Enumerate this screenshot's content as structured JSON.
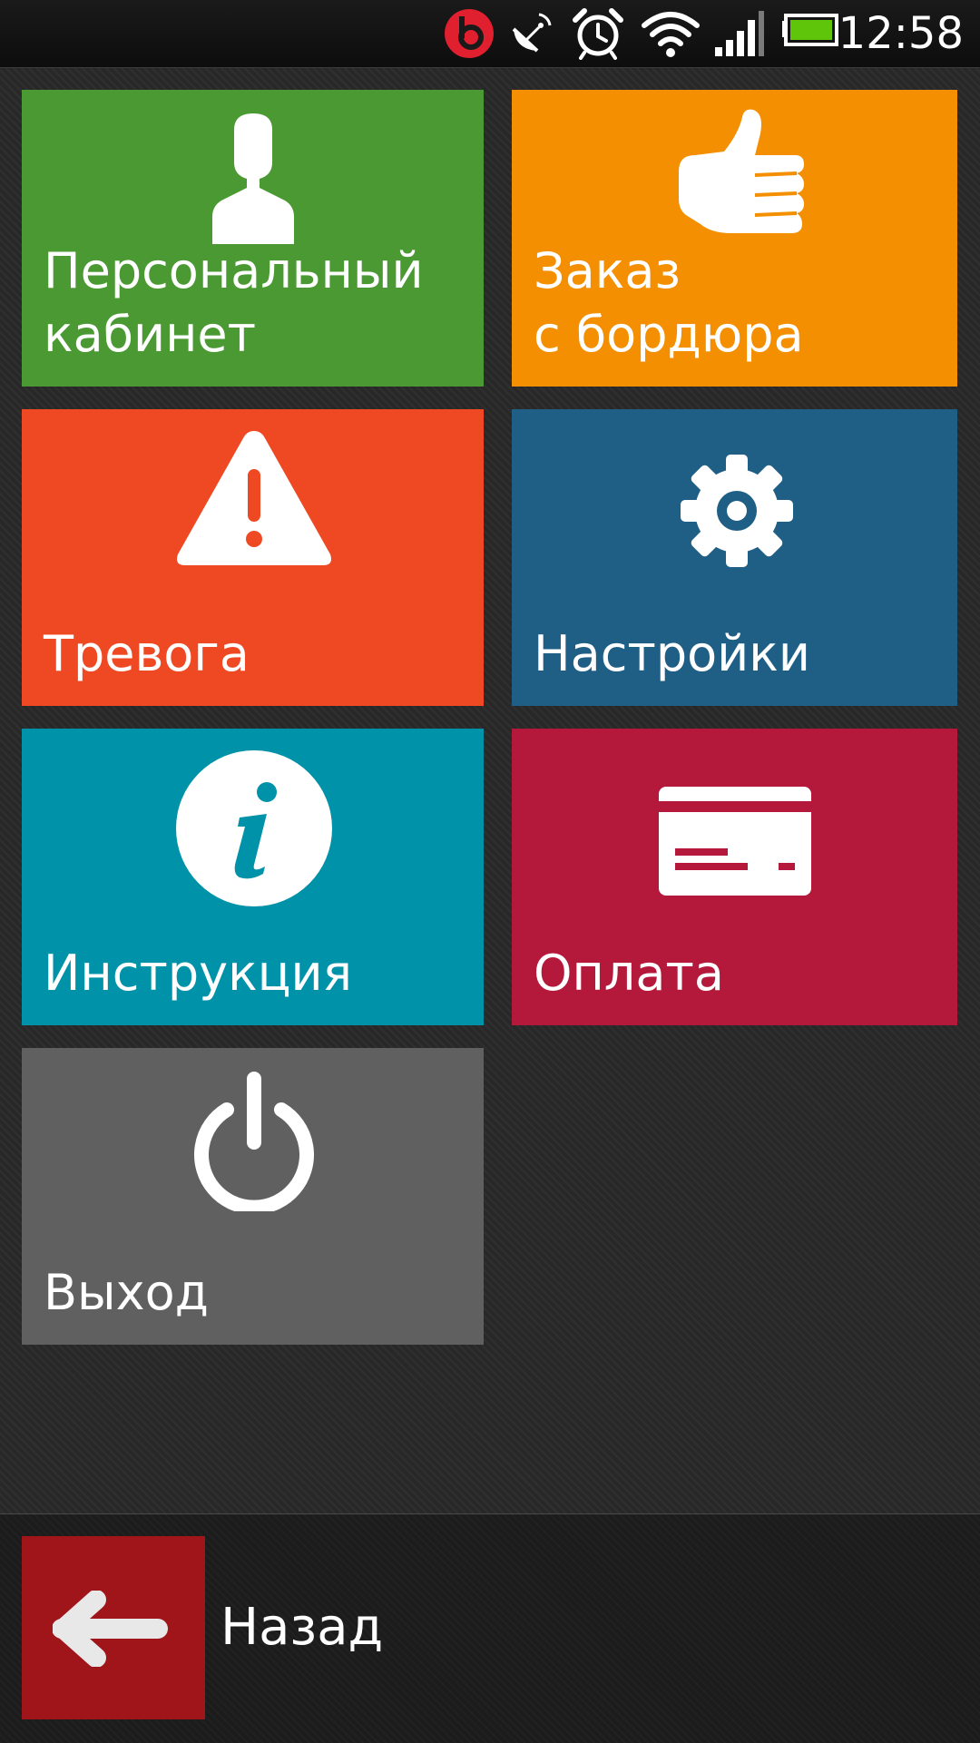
{
  "status_bar": {
    "time": "12:58",
    "icons": [
      "beats-audio-icon",
      "satellite-dish-icon",
      "alarm-clock-icon",
      "wifi-icon",
      "signal-bars-icon",
      "battery-icon"
    ],
    "battery_color": "#5fc50a",
    "beats_color": "#e01f2f"
  },
  "tiles": [
    {
      "label": "Персональный\nкабинет",
      "icon": "user-silhouette-icon",
      "color": "#4a9932"
    },
    {
      "label": "Заказ\nс бордюра",
      "icon": "thumbs-up-icon",
      "color": "#f38f00"
    },
    {
      "label": "Тревога",
      "icon": "warning-triangle-icon",
      "color": "#ef4923"
    },
    {
      "label": "Настройки",
      "icon": "gear-icon",
      "color": "#1f5f86"
    },
    {
      "label": "Инструкция",
      "icon": "info-icon",
      "color": "#0092a8"
    },
    {
      "label": "Оплата",
      "icon": "credit-card-icon",
      "color": "#b4183b"
    },
    {
      "label": "Выход",
      "icon": "power-icon",
      "color": "#606060"
    }
  ],
  "bottom_bar": {
    "back_label": "Назад",
    "back_icon": "arrow-left-icon",
    "back_color": "#a0151a"
  }
}
